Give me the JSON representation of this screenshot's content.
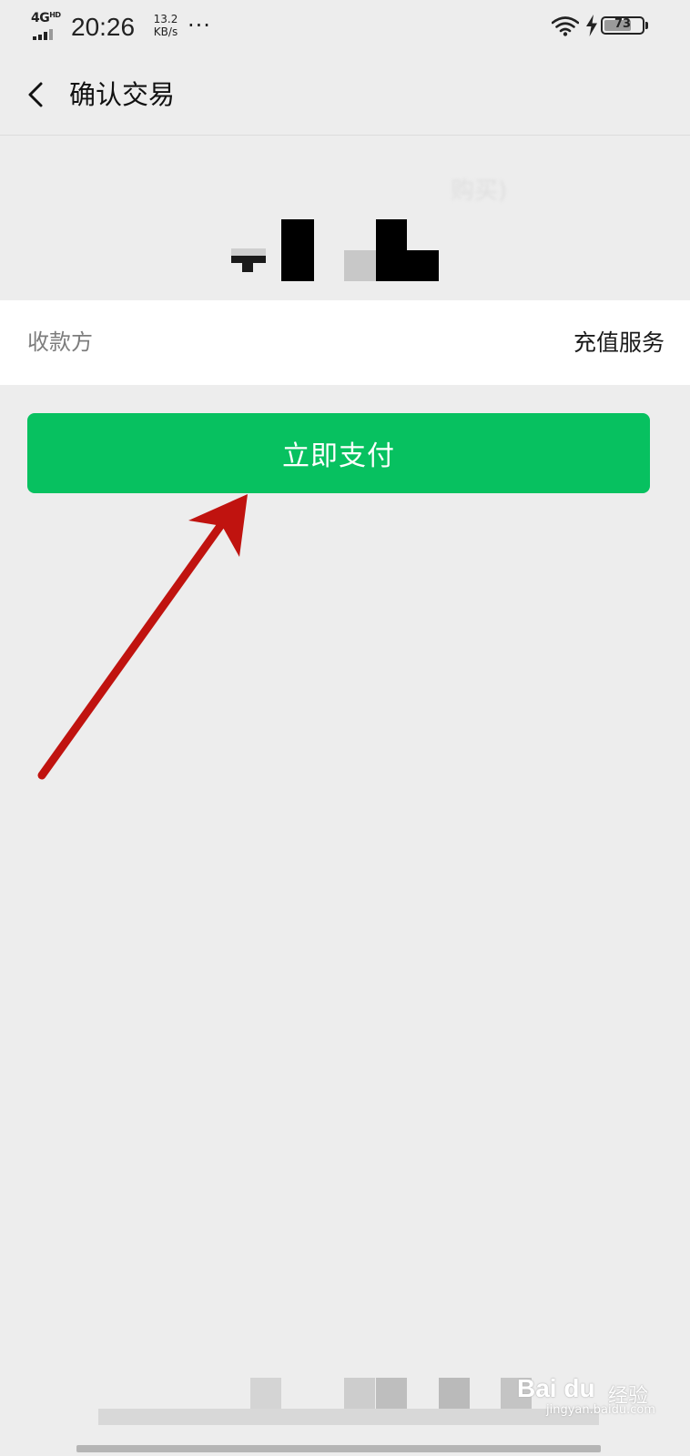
{
  "status_bar": {
    "network": "4G",
    "network_sup": "HD",
    "time": "20:26",
    "speed_value": "13.2",
    "speed_unit": "KB/s",
    "more": "···",
    "battery": "73",
    "battery_level_percent": 73
  },
  "header": {
    "back_icon": "chevron-left-icon",
    "title": "确认交易"
  },
  "product": {
    "name_partial": "购买)"
  },
  "payee": {
    "label": "收款方",
    "value": "充值服务"
  },
  "pay_button": {
    "label": "立即支付",
    "color": "#07c160"
  },
  "annotation": {
    "arrow_color": "#c0130f"
  },
  "watermark": {
    "brand": "Bai du",
    "sub": "经验",
    "url": "jingyan.baidu.com"
  },
  "colors": {
    "background": "#ededed",
    "row_background": "#ffffff",
    "label_gray": "#7d7d7d"
  }
}
